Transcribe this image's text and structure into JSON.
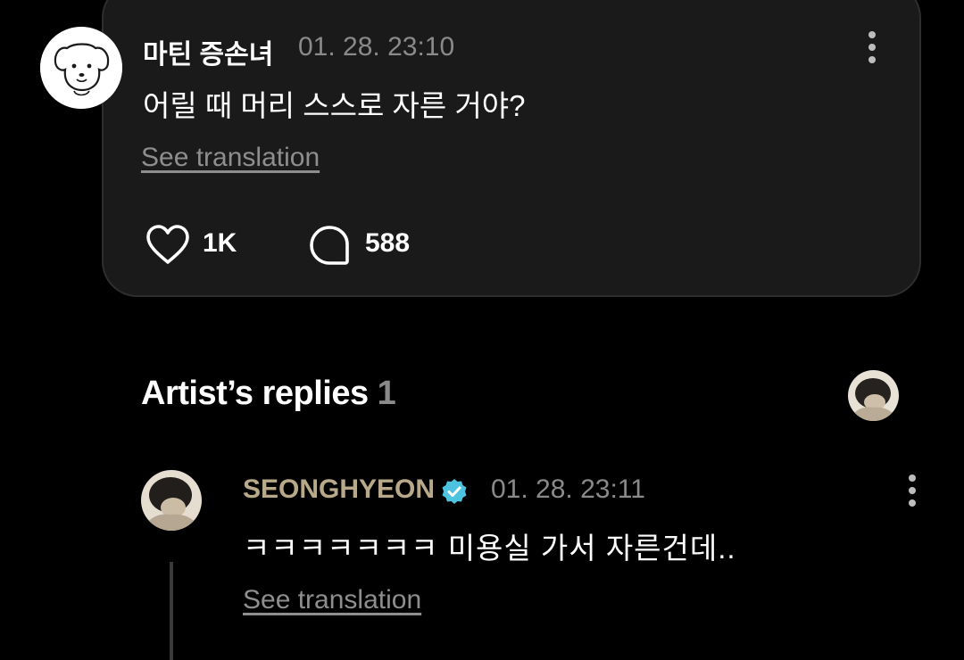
{
  "post": {
    "author": "마틴 증손녀",
    "timestamp": "01. 28. 23:10",
    "text": "어릴 때 머리 스스로 자른 거야?",
    "translate_label": "See translation",
    "likes": "1K",
    "comments": "588"
  },
  "artist_replies": {
    "title": "Artist’s replies",
    "count": "1"
  },
  "reply": {
    "author": "SEONGHYEON",
    "timestamp": "01. 28. 23:11",
    "text": "ㅋㅋㅋㅋㅋㅋㅋ 미용실 가서 자른건데..",
    "translate_label": "See translation"
  },
  "colors": {
    "background": "#000000",
    "card": "#1a1a1a",
    "artist_name": "#b8a98a",
    "verified": "#4ec3e0",
    "muted": "#8a8a8a"
  },
  "icons": {
    "post_avatar": "puppy-avatar-icon",
    "like": "heart-icon",
    "comment": "comment-bubble-icon",
    "menu": "more-vertical-icon",
    "verified": "verified-badge-icon"
  }
}
